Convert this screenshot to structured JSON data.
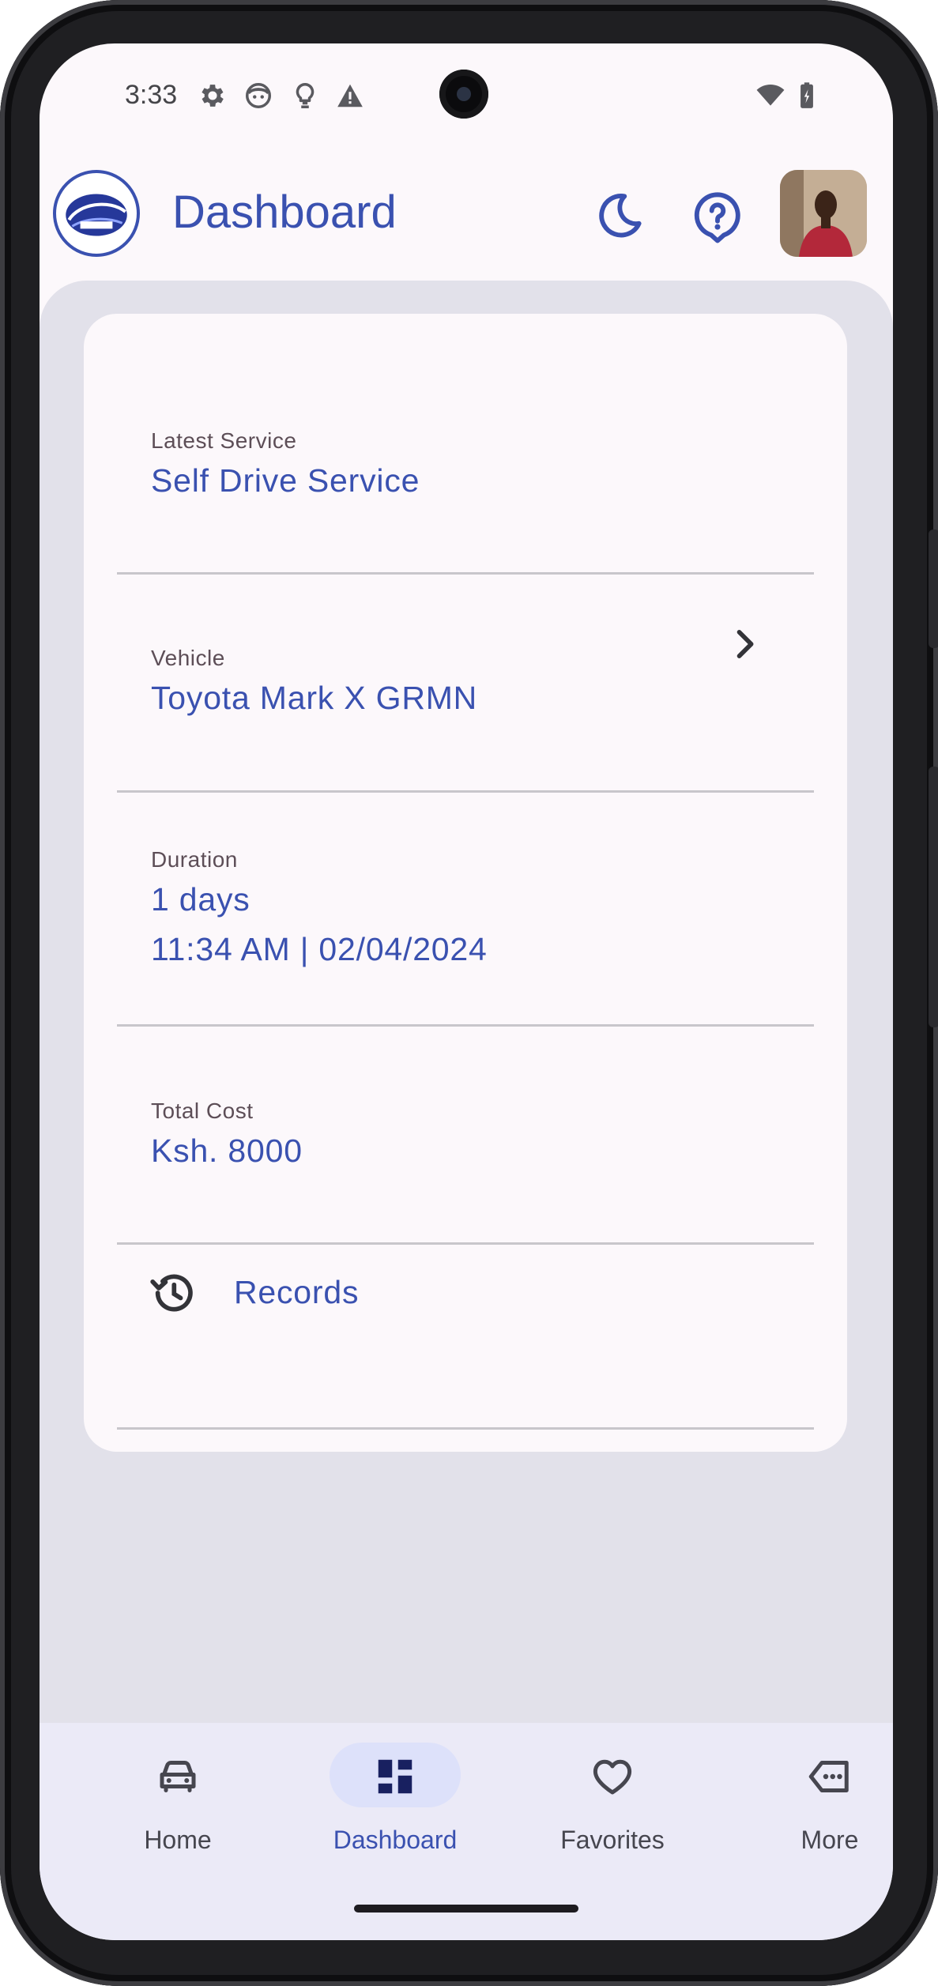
{
  "status_bar": {
    "time": "3:33"
  },
  "header": {
    "title": "Dashboard"
  },
  "dashboard": {
    "latest_service": {
      "label": "Latest Service",
      "value": "Self Drive Service"
    },
    "vehicle": {
      "label": "Vehicle",
      "value": "Toyota Mark X GRMN"
    },
    "duration": {
      "label": "Duration",
      "days": "1 days",
      "datetime": "11:34 AM | 02/04/2024"
    },
    "total_cost": {
      "label": "Total Cost",
      "value": "Ksh. 8000"
    },
    "records": {
      "label": "Records"
    }
  },
  "nav": {
    "items": [
      {
        "label": "Home",
        "icon": "car-icon"
      },
      {
        "label": "Dashboard",
        "icon": "dashboard-icon",
        "active": true
      },
      {
        "label": "Favorites",
        "icon": "heart-icon"
      },
      {
        "label": "More",
        "icon": "more-icon"
      }
    ]
  },
  "colors": {
    "primary": "#3a51b0",
    "label": "#5d4e57",
    "surface": "#fcf8fb",
    "content_bg": "#e2e1ea",
    "nav_bg": "#ebeaf7",
    "nav_pill": "#dde1fa"
  }
}
